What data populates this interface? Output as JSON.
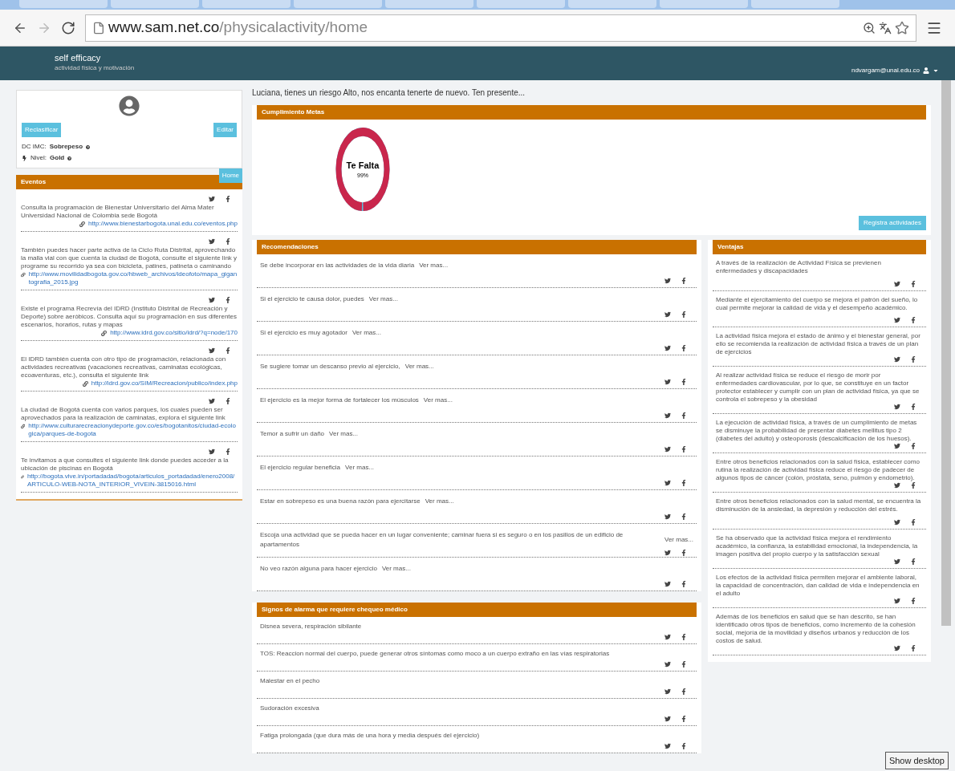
{
  "browser": {
    "url_host": "www.sam.net.co",
    "url_path": "/physicalactivity/home"
  },
  "header": {
    "brand": "self efficacy",
    "tagline": "actividad física y motivación",
    "user": "ndvargam@unal.edu.co"
  },
  "profile": {
    "reclassify_button": "Reclasificar",
    "edit_button": "Editar",
    "bmi_label": "DC IMC:",
    "bmi_value": "Sobrepeso",
    "level_label": "Nivel:",
    "level_value": "Gold"
  },
  "events": {
    "title": "Eventos",
    "home_tab": "Home",
    "items": [
      {
        "text": "Consulta la programación de Bienestar Universitario del Alma Mater Universidad Nacional de Colombia sede Bogotá",
        "link": "http://www.bienestarbogota.unal.edu.co/eventos.php"
      },
      {
        "text": "También puedes hacer parte activa de la Ciclo Ruta Distrital, aprovechando la malla vial con que cuenta la ciudad de Bogotá, consulte el siguiente link y programe su recorrido ya sea con bicicleta, patines, patineta o caminando",
        "link": "http://www.movilidadbogota.gov.co/hbweb_archivos/ideofoto/mapa_gigantografia_2015.jpg"
      },
      {
        "text": "Existe el programa Recrevía del IDRD (Instituto Distrital de Recreación y Deporte) sobre aeróbicos. Consulta aquí su programación en sus diferentes escenarios, horarios, rutas y mapas",
        "link": "http://www.idrd.gov.co/sitio/idrd/?q=node/170"
      },
      {
        "text": "El IDRD también cuenta con otro tipo de programación, relacionada con actividades recreativas (vacaciones recreativas, caminatas ecológicas, ecoaventuras, etc.), consulta el siguiente link",
        "link": "http://idrd.gov.co/SIM/Recreacion/publico/index.php"
      },
      {
        "text": "La ciudad de Bogotá cuenta con varios parques, los cuales pueden ser aprovechados para la realización de caminatas, explora el siguiente link",
        "link": "http://www.culturarecreacionydeporte.gov.co/es/bogotanitos/ciudad-ecologica/parques-de-bogota"
      },
      {
        "text": "Te invitamos a que consultes el siguiente link donde puedes acceder a la ubicación de piscinas en Bogotá",
        "link": "http://bogota.vive.in/portadadad/bogota/articulos_portadadad/enero2008/ARTICULO-WEB-NOTA_INTERIOR_VIVEIN-3815016.html"
      }
    ]
  },
  "welcome": "Luciana, tienes un riesgo Alto, nos encanta tenerte de nuevo. Ten presente...",
  "goals": {
    "title": "Cumplimiento Metas",
    "meter_title": "Te Falta",
    "meter_reading": "99%",
    "level": 0.99,
    "register_button": "Registra actividades"
  },
  "recommendations": {
    "title": "Recomendaciones",
    "items": [
      {
        "text": "Se debe incorporar en las actividades de la vida diaria",
        "more": "Ver mas..."
      },
      {
        "text": "Si el ejercicio te causa dolor, puedes",
        "more": "Ver mas..."
      },
      {
        "text": "Si el ejercicio es muy agotador",
        "more": "Ver mas..."
      },
      {
        "text": "Se sugiere tomar un descanso previo al ejercicio,",
        "more": "Ver mas..."
      },
      {
        "text": "El ejercicio es la mejor forma de fortalecer los músculos",
        "more": "Ver mas..."
      },
      {
        "text": "Temor a sufrir un daño",
        "more": "Ver mas..."
      },
      {
        "text": "El ejercicio regular beneficia",
        "more": "Ver mas..."
      },
      {
        "text": "Estar en sobrepeso es una buena razón para ejercitarse",
        "more": "Ver mas..."
      },
      {
        "text": "Escoja una actividad que se pueda hacer en un lugar conveniente; caminar fuera si es seguro o en los pasillos de un edificio de apartamentos",
        "more": "Ver mas..."
      },
      {
        "text": "No veo razón alguna para hacer ejercicio",
        "more": "Ver mas..."
      }
    ]
  },
  "advantages": {
    "title": "Ventajas",
    "items": [
      "A través de la realización de Actividad Física se previenen enfermedades y discapacidades",
      "Mediante el ejercitamiento del cuerpo se mejora el patrón del sueño, lo cual permite mejorar la calidad de vida y el desempeño académico.",
      "La actividad física mejora el estado de ánimo y el bienestar general, por ello se recomienda la realización de actividad física a través de un plan de ejercicios",
      "Al realizar actividad física se reduce el riesgo de morir por enfermedades cardiovascular, por lo que, se constituye en un factor protector establecer y cumplir con un plan de actividad física, ya que se controla el sobrepeso y la obesidad",
      "La ejecución de actividad física, a través de un cumplimiento de metas se disminuye la probabilidad de presentar diabetes mellitus tipo 2 (diabetes del adulto) y osteoporosis (descalcificación de los huesos).",
      "Entre otros beneficios relacionados con la salud física, establecer como rutina la realización de actividad física reduce el riesgo de padecer de algunos tipos de cáncer (colón, próstata, seno, pulmón y endometrio).",
      "Entre otros beneficios relacionados con la salud mental, se encuentra la disminución de la ansiedad, la depresión y reducción del estrés.",
      "Se ha observado que la actividad física mejora el rendimiento académico, la confianza, la estabilidad emocional, la independencia, la imagen positiva del propio cuerpo y la satisfacción sexual",
      "Los efectos de la actividad física permiten mejorar el ambiente laboral, la capacidad de concentración, dan calidad de vida e independencia en el adulto",
      "Además de los beneficios en salud que se han descrito, se han identificado otros tipos de beneficios, como incremento de la cohesión social, mejoría de la movilidad y diseños urbanos y reducción de los costos de salud."
    ]
  },
  "warning_signs": {
    "title": "Signos de alarma que requiere chequeo médico",
    "items": [
      "Disnea severa, respiración sibilante",
      "TOS: Reaccion normal del cuerpo, puede generar otros síntomas como moco a un cuerpo extraño en las vías respiratorias",
      "Malestar en el pecho",
      "Sudoración excesiva",
      "Fatiga prolongada (que dura más de una hora y media después del ejercicio)"
    ]
  },
  "tooltip": "Show desktop"
}
